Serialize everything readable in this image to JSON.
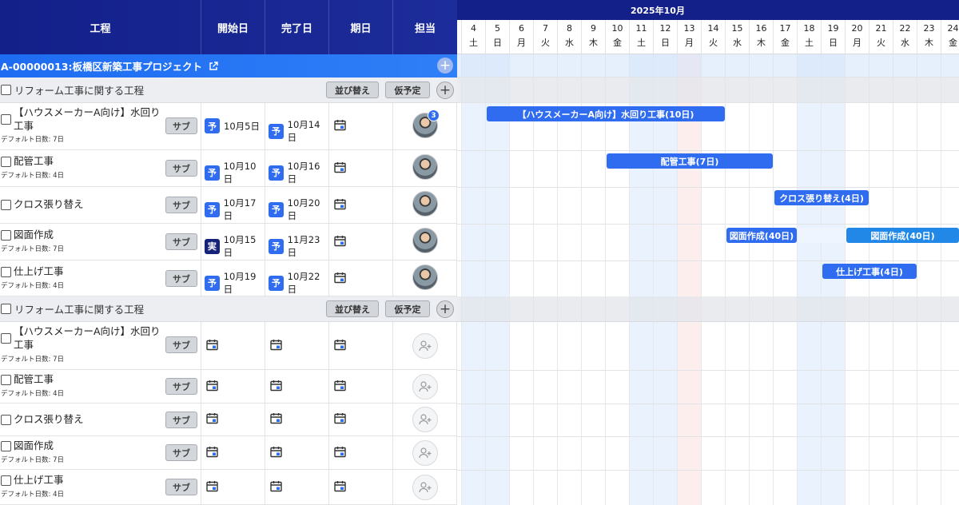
{
  "columns": {
    "name": "工程",
    "start": "開始日",
    "end": "完了日",
    "deadline": "期日",
    "assignee": "担当"
  },
  "project": {
    "title": "A-00000013:板橋区新築工事プロジェクト",
    "plus": "+"
  },
  "group_buttons": {
    "sort": "並び替え",
    "tentative": "仮予定",
    "plus": "+"
  },
  "sub_label": "サブ",
  "badges": {
    "plan": "予",
    "actual": "実"
  },
  "groups": [
    {
      "label": "リフォーム工事に関する工程"
    },
    {
      "label": "リフォーム工事に関する工程"
    }
  ],
  "tasks_group1": [
    {
      "name": "【ハウスメーカーA向け】水回り工事",
      "default_days": "デフォルト日数: 7日",
      "start": "10月5日",
      "end": "10月14日",
      "assignee_count": "3"
    },
    {
      "name": "配管工事",
      "default_days": "デフォルト日数: 4日",
      "start": "10月10日",
      "end": "10月16日"
    },
    {
      "name": "クロス張り替え",
      "default_days": "",
      "start": "10月17日",
      "end": "10月20日"
    },
    {
      "name": "図面作成",
      "default_days": "デフォルト日数: 7日",
      "start": "10月15日",
      "end": "11月23日"
    },
    {
      "name": "仕上げ工事",
      "default_days": "デフォルト日数: 4日",
      "start": "10月19日",
      "end": "10月22日"
    }
  ],
  "tasks_group2": [
    {
      "name": "【ハウスメーカーA向け】水回り工事",
      "default_days": "デフォルト日数: 7日"
    },
    {
      "name": "配管工事",
      "default_days": "デフォルト日数: 4日"
    },
    {
      "name": "クロス張り替え",
      "default_days": ""
    },
    {
      "name": "図面作成",
      "default_days": "デフォルト日数: 7日"
    },
    {
      "name": "仕上げ工事",
      "default_days": "デフォルト日数: 4日"
    }
  ],
  "gantt": {
    "month": "2025年10月",
    "days": [
      {
        "d": "4",
        "w": "土",
        "type": "we"
      },
      {
        "d": "5",
        "w": "日",
        "type": "we"
      },
      {
        "d": "6",
        "w": "月",
        "type": ""
      },
      {
        "d": "7",
        "w": "火",
        "type": ""
      },
      {
        "d": "8",
        "w": "水",
        "type": ""
      },
      {
        "d": "9",
        "w": "木",
        "type": ""
      },
      {
        "d": "10",
        "w": "金",
        "type": ""
      },
      {
        "d": "11",
        "w": "土",
        "type": "we"
      },
      {
        "d": "12",
        "w": "日",
        "type": "we"
      },
      {
        "d": "13",
        "w": "月",
        "type": "hol"
      },
      {
        "d": "14",
        "w": "火",
        "type": ""
      },
      {
        "d": "15",
        "w": "水",
        "type": ""
      },
      {
        "d": "16",
        "w": "木",
        "type": ""
      },
      {
        "d": "17",
        "w": "金",
        "type": ""
      },
      {
        "d": "18",
        "w": "土",
        "type": "we"
      },
      {
        "d": "19",
        "w": "日",
        "type": "we"
      },
      {
        "d": "20",
        "w": "月",
        "type": ""
      },
      {
        "d": "21",
        "w": "火",
        "type": ""
      },
      {
        "d": "22",
        "w": "水",
        "type": ""
      },
      {
        "d": "23",
        "w": "木",
        "type": ""
      },
      {
        "d": "24",
        "w": "金",
        "type": ""
      }
    ],
    "bars": [
      {
        "label": "【ハウスメーカーA向け】水回り工事(10日)",
        "start": 5,
        "end": 14
      },
      {
        "label": "配管工事(7日)",
        "start": 10,
        "end": 16
      },
      {
        "label": "クロス張り替え(4日)",
        "start": 17,
        "end": 20
      },
      {
        "label": "図面作成(40日)",
        "start": 15,
        "end": 17
      },
      {
        "label": "図面作成(40日)",
        "start": 20,
        "end": 24
      },
      {
        "label": "仕上げ工事(4日)",
        "start": 19,
        "end": 22
      }
    ]
  }
}
